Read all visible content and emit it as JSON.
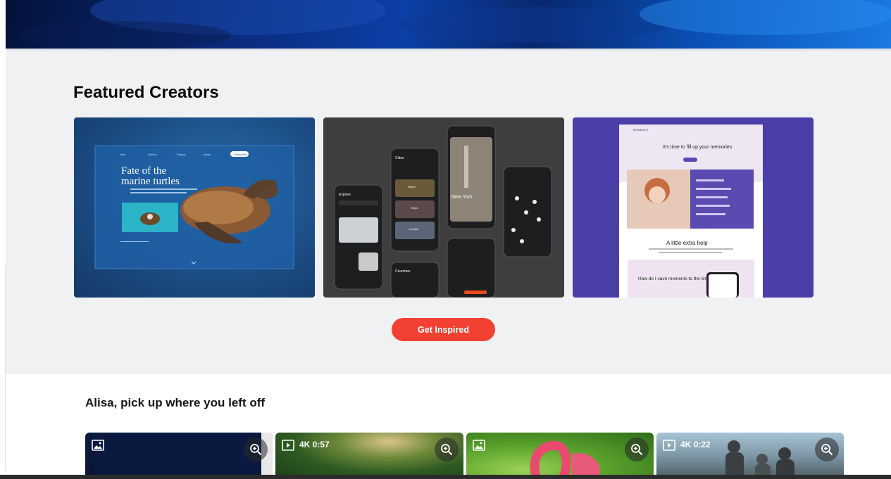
{
  "featured": {
    "title": "Featured Creators",
    "cta_label": "Get Inspired",
    "cards": [
      {
        "nav": [
          "Nav",
          "Gallery",
          "Photos",
          "Ideas"
        ],
        "subscribe_label": "Subscribe",
        "heading_line1": "Fate of the",
        "heading_line2": "marine turtles"
      },
      {
        "screen_explore": "Explore",
        "screen_cities": "Cities",
        "screen_city_name": "New York",
        "screen_countries": "Countries",
        "city_items": [
          "Hanoi",
          "Tokyo",
          "London"
        ]
      },
      {
        "brand": "MOMENTO",
        "headline": "It's time to fill up your memories",
        "section_title": "A little extra help",
        "faq_title": "How do I save moments to the timeline?"
      }
    ]
  },
  "resume": {
    "title": "Alisa, pick up where you left off",
    "items": [
      {
        "type": "image-icon",
        "duration": ""
      },
      {
        "type": "video-icon",
        "duration": "4K 0:57"
      },
      {
        "type": "image-icon",
        "duration": ""
      },
      {
        "type": "video-icon",
        "duration": "4K 0:22"
      }
    ]
  },
  "colors": {
    "accent": "#f24032",
    "featured_bg": "#f0f1f3",
    "card3_bg": "#4a3ea8"
  }
}
